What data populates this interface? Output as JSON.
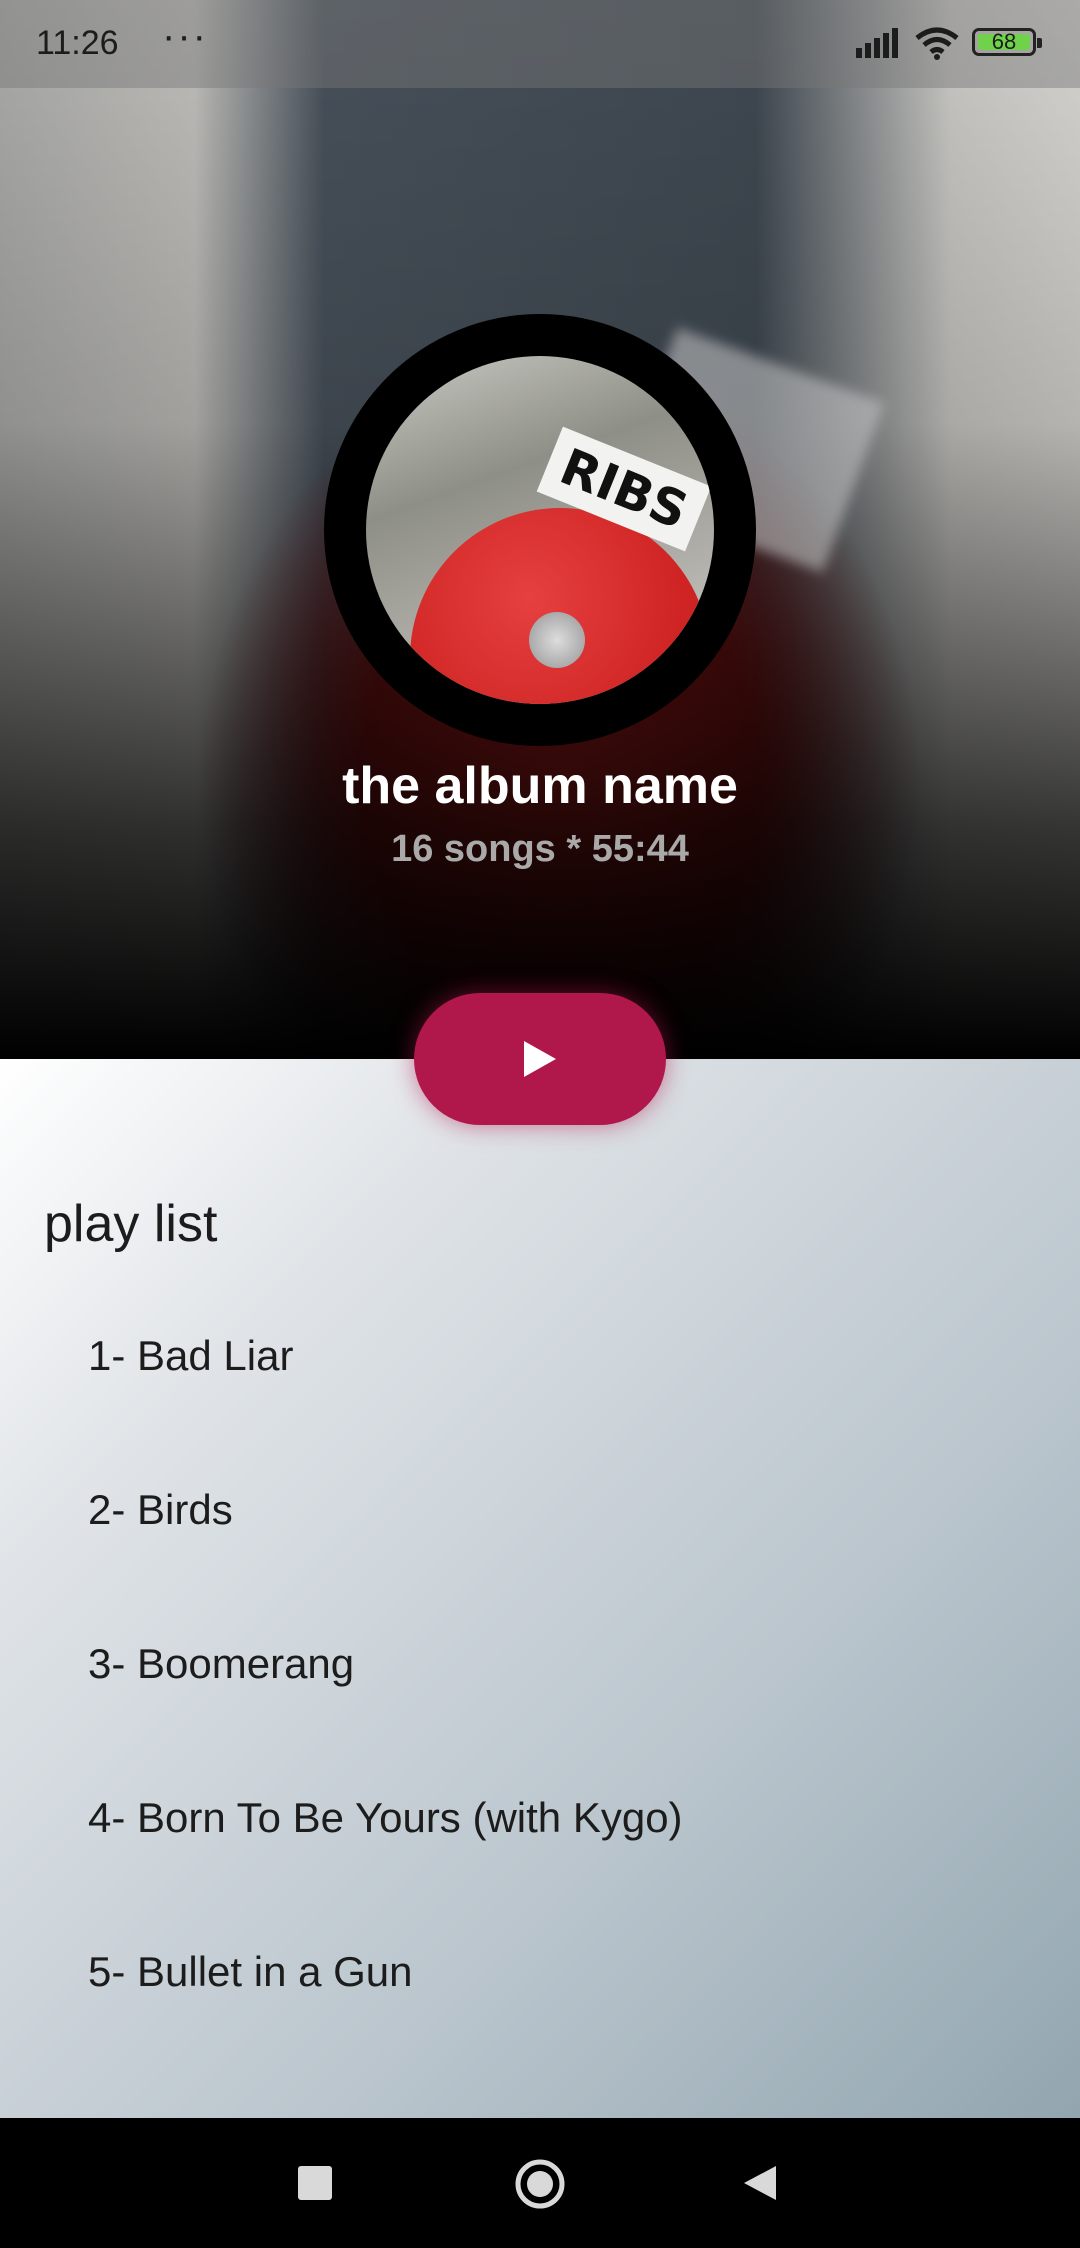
{
  "status_bar": {
    "time": "11:26",
    "more": "···",
    "battery_level": "68"
  },
  "album": {
    "title": "the album name",
    "subtitle": "16 songs * 55:44",
    "art_sticker_text": "RIBS"
  },
  "colors": {
    "accent": "#b0174a",
    "battery": "#6fd24a"
  },
  "playlist": {
    "heading": "play list",
    "songs": [
      "1- Bad Liar",
      "2- Birds",
      "3- Boomerang",
      "4- Born To Be Yours (with Kygo)",
      "5- Bullet in a Gun"
    ]
  },
  "icons": {
    "play": "play-icon",
    "nav_recents": "square-icon",
    "nav_home": "circle-icon",
    "nav_back": "triangle-back-icon"
  }
}
